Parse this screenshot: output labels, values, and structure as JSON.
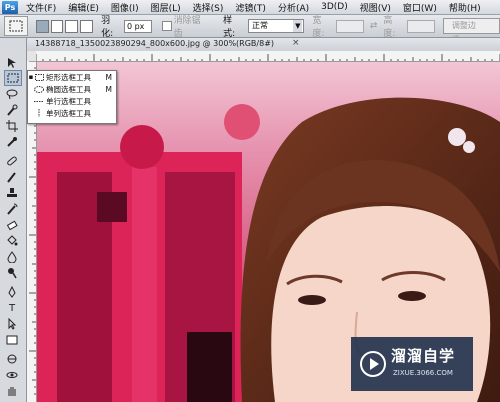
{
  "menubar": {
    "logo": "Ps",
    "items": [
      {
        "label": "文件(F)"
      },
      {
        "label": "编辑(E)"
      },
      {
        "label": "图像(I)"
      },
      {
        "label": "图层(L)"
      },
      {
        "label": "选择(S)"
      },
      {
        "label": "滤镜(T)"
      },
      {
        "label": "分析(A)"
      },
      {
        "label": "3D(D)"
      },
      {
        "label": "视图(V)"
      },
      {
        "label": "窗口(W)"
      },
      {
        "label": "帮助(H)"
      }
    ]
  },
  "options": {
    "feather_label": "羽化:",
    "feather_value": "0 px",
    "antialias_label": "消除锯齿",
    "style_label": "样式:",
    "style_value": "正常",
    "width_label": "宽度:",
    "height_label": "高度:",
    "refine_edge": "调整边缘..."
  },
  "document": {
    "tab_title": "14388718_1350023890294_800x600.jpg @ 300%(RGB/8#)",
    "close": "×"
  },
  "tool_popup": {
    "items": [
      {
        "label": "矩形选框工具",
        "shortcut": "M",
        "selected": true
      },
      {
        "label": "椭圆选框工具",
        "shortcut": "M",
        "selected": false
      },
      {
        "label": "单行选框工具",
        "shortcut": "",
        "selected": false
      },
      {
        "label": "单列选框工具",
        "shortcut": "",
        "selected": false
      }
    ]
  },
  "watermark": {
    "title": "溜溜自学",
    "url": "ZIXUE.3066.COM"
  },
  "colors": {
    "background_pink": "#c82452",
    "shelf_red": "#e0245a",
    "watermark_bg": "#1a2c48"
  }
}
